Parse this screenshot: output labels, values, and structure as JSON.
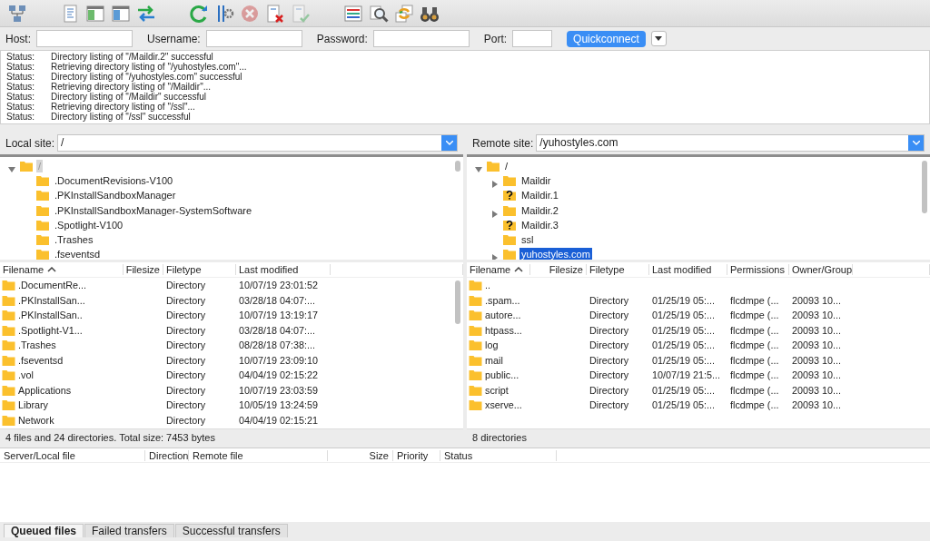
{
  "toolbar": [
    {
      "kind": "network",
      "disabled": false
    },
    {
      "kind": "gap"
    },
    {
      "kind": "document",
      "disabled": false
    },
    {
      "kind": "pane-left",
      "disabled": false
    },
    {
      "kind": "pane-top",
      "disabled": false
    },
    {
      "kind": "arrows",
      "disabled": false
    },
    {
      "kind": "gap"
    },
    {
      "kind": "refresh",
      "disabled": false
    },
    {
      "kind": "sliders",
      "disabled": false
    },
    {
      "kind": "cancel",
      "disabled": true
    },
    {
      "kind": "doc-x",
      "disabled": false
    },
    {
      "kind": "doc-check",
      "disabled": true
    },
    {
      "kind": "gap"
    },
    {
      "kind": "list",
      "disabled": false
    },
    {
      "kind": "search",
      "disabled": false
    },
    {
      "kind": "sync",
      "disabled": false
    },
    {
      "kind": "binoculars",
      "disabled": false
    }
  ],
  "quickconnect": {
    "fields": [
      {
        "label": "Host:"
      },
      {
        "label": "Username:"
      },
      {
        "label": "Password:"
      },
      {
        "label": "Port:"
      }
    ],
    "button": "Quickconnect"
  },
  "log": [
    {
      "label": "Status:",
      "message": "Directory listing of \"/Maildir.2\" successful"
    },
    {
      "label": "Status:",
      "message": "Retrieving directory listing of \"/yuhostyles.com\"..."
    },
    {
      "label": "Status:",
      "message": "Directory listing of \"/yuhostyles.com\" successful"
    },
    {
      "label": "Status:",
      "message": "Retrieving directory listing of \"/Maildir\"..."
    },
    {
      "label": "Status:",
      "message": "Directory listing of \"/Maildir\" successful"
    },
    {
      "label": "Status:",
      "message": "Retrieving directory listing of \"/ssl\"..."
    },
    {
      "label": "Status:",
      "message": "Directory listing of \"/ssl\" successful"
    }
  ],
  "local": {
    "site_label": "Local site:",
    "path": "/",
    "focused": false,
    "tree": [
      {
        "label": "/",
        "kind": "folder",
        "expandable": true,
        "expanded": true,
        "selected": true,
        "children": [
          {
            "label": ".DocumentRevisions-V100",
            "kind": "folder",
            "expandable": false,
            "expanded": false,
            "selected": false
          },
          {
            "label": ".PKInstallSandboxManager",
            "kind": "folder",
            "expandable": false,
            "expanded": false,
            "selected": false
          },
          {
            "label": ".PKInstallSandboxManager-SystemSoftware",
            "kind": "folder",
            "expandable": false,
            "expanded": false,
            "selected": false
          },
          {
            "label": ".Spotlight-V100",
            "kind": "folder",
            "expandable": false,
            "expanded": false,
            "selected": false
          },
          {
            "label": ".Trashes",
            "kind": "folder",
            "expandable": false,
            "expanded": false,
            "selected": false
          },
          {
            "label": ".fseventsd",
            "kind": "folder",
            "expandable": false,
            "expanded": false,
            "selected": false
          }
        ]
      }
    ],
    "columns": [
      "Filename",
      "Filesize",
      "Filetype",
      "Last modified"
    ],
    "rows": [
      [
        ".DocumentRe...",
        "",
        "Directory",
        "10/07/19 23:01:52"
      ],
      [
        ".PKInstallSan...",
        "",
        "Directory",
        "03/28/18 04:07:..."
      ],
      [
        ".PKInstallSan..",
        "",
        "Directory",
        "10/07/19 13:19:17"
      ],
      [
        ".Spotlight-V1...",
        "",
        "Directory",
        "03/28/18 04:07:..."
      ],
      [
        ".Trashes",
        "",
        "Directory",
        "08/28/18 07:38:..."
      ],
      [
        ".fseventsd",
        "",
        "Directory",
        "10/07/19 23:09:10"
      ],
      [
        ".vol",
        "",
        "Directory",
        "04/04/19 02:15:22"
      ],
      [
        "Applications",
        "",
        "Directory",
        "10/07/19 23:03:59"
      ],
      [
        "Library",
        "",
        "Directory",
        "10/05/19 13:24:59"
      ],
      [
        "Network",
        "",
        "Directory",
        "04/04/19 02:15:21"
      ]
    ],
    "status": "4 files and 24 directories. Total size: 7453 bytes"
  },
  "remote": {
    "site_label": "Remote site:",
    "path": "/yuhostyles.com",
    "focused": true,
    "tree": [
      {
        "label": "/",
        "kind": "folder",
        "expandable": true,
        "expanded": true,
        "selected": false,
        "children": [
          {
            "label": "Maildir",
            "kind": "folder",
            "expandable": true,
            "expanded": false,
            "selected": false
          },
          {
            "label": "Maildir.1",
            "kind": "unknown",
            "expandable": false,
            "expanded": false,
            "selected": false
          },
          {
            "label": "Maildir.2",
            "kind": "folder",
            "expandable": true,
            "expanded": false,
            "selected": false
          },
          {
            "label": "Maildir.3",
            "kind": "unknown",
            "expandable": false,
            "expanded": false,
            "selected": false
          },
          {
            "label": "ssl",
            "kind": "folder",
            "expandable": false,
            "expanded": false,
            "selected": false
          },
          {
            "label": "yuhostyles.com",
            "kind": "folder",
            "expandable": true,
            "expanded": false,
            "selected": true
          }
        ]
      }
    ],
    "columns": [
      "Filename",
      "Filesize",
      "Filetype",
      "Last modified",
      "Permissions",
      "Owner/Group"
    ],
    "rows": [
      [
        "..",
        "",
        "",
        "",
        "",
        ""
      ],
      [
        ".spam...",
        "",
        "Directory",
        "01/25/19 05:...",
        "flcdmpe (...",
        "20093 10..."
      ],
      [
        "autore...",
        "",
        "Directory",
        "01/25/19 05:...",
        "flcdmpe (...",
        "20093 10..."
      ],
      [
        "htpass...",
        "",
        "Directory",
        "01/25/19 05:...",
        "flcdmpe (...",
        "20093 10..."
      ],
      [
        "log",
        "",
        "Directory",
        "01/25/19 05:...",
        "flcdmpe (...",
        "20093 10..."
      ],
      [
        "mail",
        "",
        "Directory",
        "01/25/19 05:...",
        "flcdmpe (...",
        "20093 10..."
      ],
      [
        "public...",
        "",
        "Directory",
        "10/07/19 21:5...",
        "flcdmpe (...",
        "20093 10..."
      ],
      [
        "script",
        "",
        "Directory",
        "01/25/19 05:...",
        "flcdmpe (...",
        "20093 10..."
      ],
      [
        "xserve...",
        "",
        "Directory",
        "01/25/19 05:...",
        "flcdmpe (...",
        "20093 10..."
      ]
    ],
    "status": "8 directories"
  },
  "queue": {
    "columns": [
      "Server/Local file",
      "Direction",
      "Remote file",
      "Size",
      "Priority",
      "Status"
    ],
    "tabs": [
      {
        "label": "Queued files",
        "selected": true
      },
      {
        "label": "Failed transfers",
        "selected": false
      },
      {
        "label": "Successful transfers",
        "selected": false
      }
    ]
  }
}
